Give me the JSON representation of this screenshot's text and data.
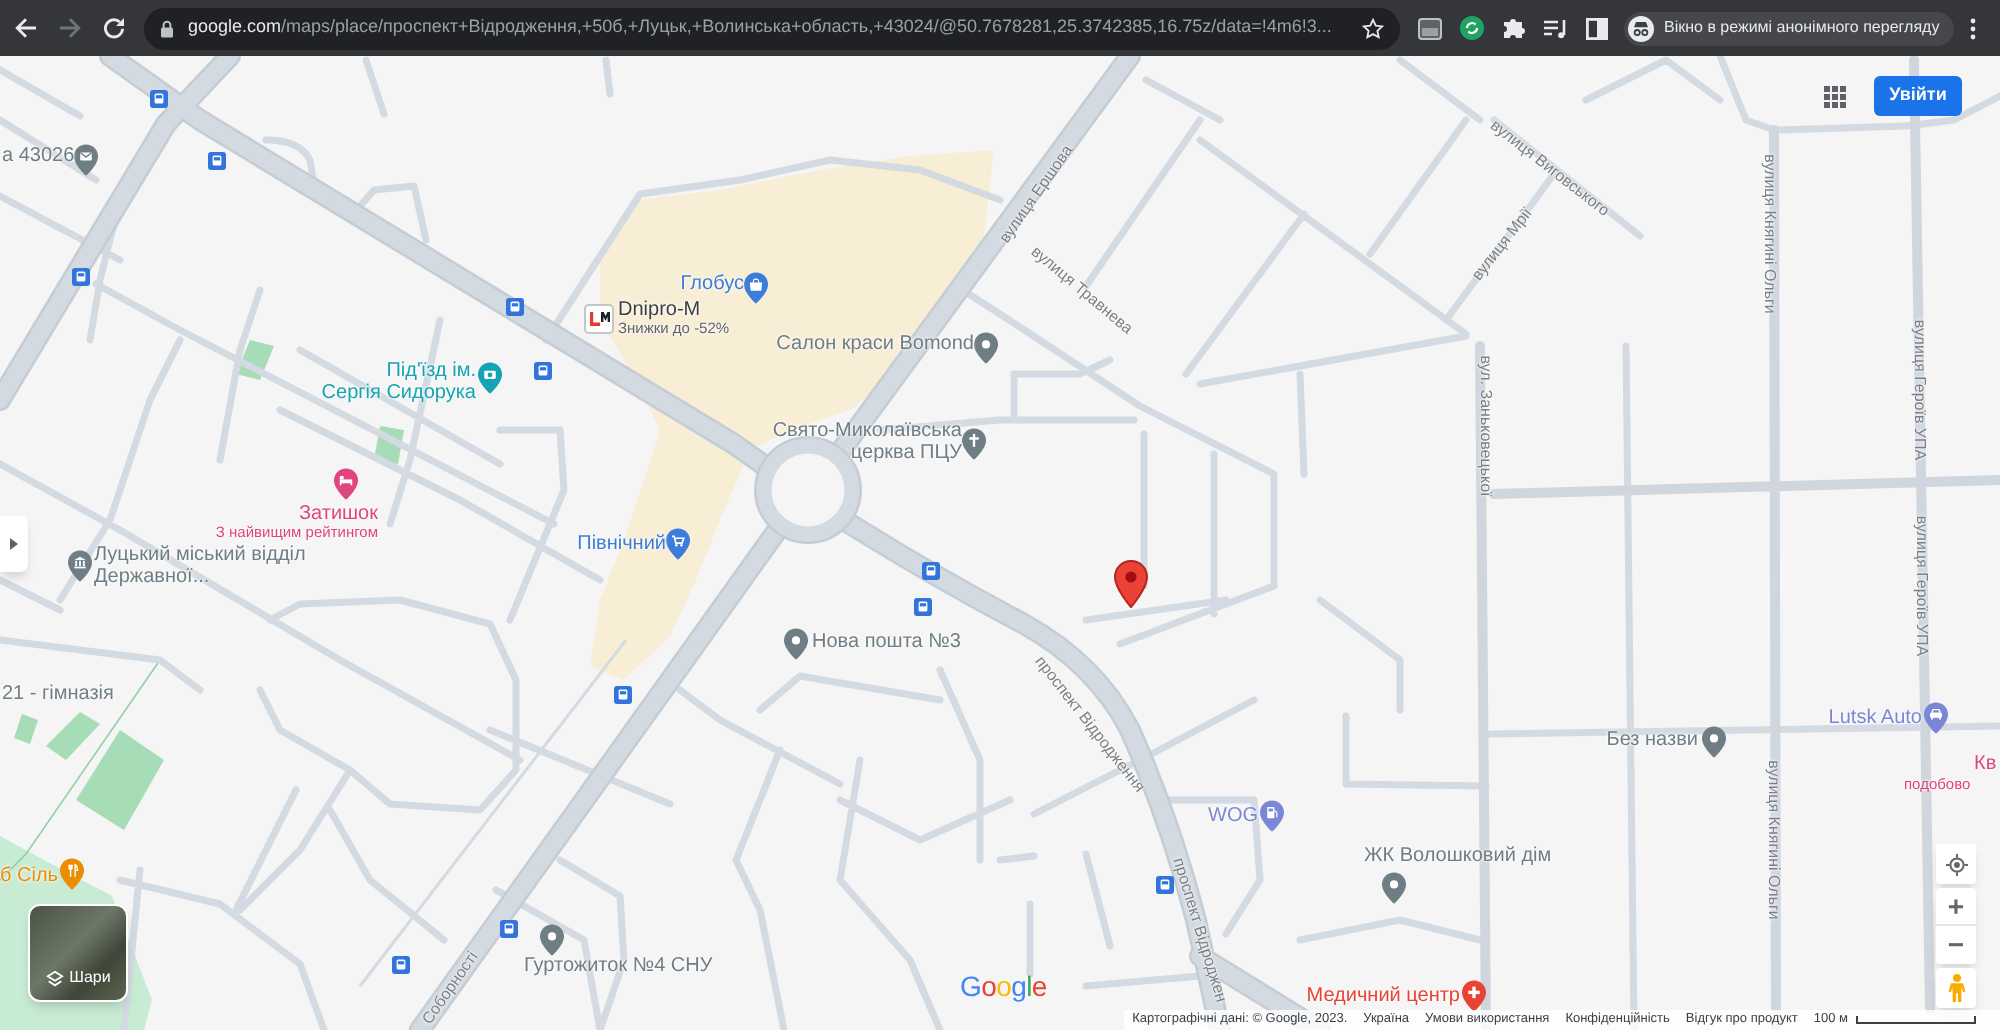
{
  "browser": {
    "forward_enabled": false,
    "url_host": "google.com",
    "url_path": "/maps/place/проспект+Відродження,+50б,+Луцьк,+Волинська+область,+43024/@50.7678281,25.3742385,16.75z/data=!4m6!3...",
    "incognito_label": "Вікно в режимі анонімного перегляду"
  },
  "header": {
    "sign_in_button": "Увійти"
  },
  "places": [
    {
      "kind": "pin",
      "name": "а 43026",
      "color": "#6f7d85"
    },
    {
      "kind": "pin",
      "name": "Глобус",
      "color": "#3c7ddc"
    },
    {
      "kind": "logo",
      "name": "Dnipro-M",
      "subtitle": "Знижки до -52%"
    },
    {
      "kind": "pin",
      "name": "Салон краси Bomond",
      "color": "#6f7d85"
    },
    {
      "kind": "pin",
      "name": "Свято-Миколаївська церква ПЦУ",
      "color": "#6f7d85"
    },
    {
      "kind": "pin",
      "name": "Під'їзд ім. Сергія Сидорука",
      "color": "#14a3b3"
    },
    {
      "kind": "pin",
      "name": "Затишок",
      "subtitle": "З найвищим рейтингом",
      "color": "#e0457f"
    },
    {
      "kind": "pin",
      "name": "Луцький міський відділ Державної...",
      "color": "#6f7d85"
    },
    {
      "kind": "pin",
      "name": "Північний",
      "color": "#3c7ddc"
    },
    {
      "kind": "pin",
      "name": "Нова пошта №3",
      "color": "#6f7d85"
    },
    {
      "kind": "label",
      "name": "21 - гімназія",
      "color": "#6f7d85"
    },
    {
      "kind": "pin",
      "name": "б Сіль",
      "color": "#ec8c00"
    },
    {
      "kind": "pin",
      "name": "Гуртожиток №4 СНУ",
      "color": "#6f7d85"
    },
    {
      "kind": "pin",
      "name": "WOG",
      "color": "#7b86d6"
    },
    {
      "kind": "pin",
      "name": "ЖК Волошковий дім",
      "color": "#6f7d85"
    },
    {
      "kind": "pin",
      "name": "Без назви",
      "color": "#6f7d85"
    },
    {
      "kind": "pin",
      "name": "Lutsk Auto",
      "color": "#7b86d6"
    },
    {
      "kind": "label",
      "name": "Кв",
      "subtitle": "подобово",
      "color": "#e0457f"
    },
    {
      "kind": "pin",
      "name": "Медичний центр",
      "color": "#ea4335"
    }
  ],
  "street_labels": [
    "вулиця Виговського",
    "вулиця Ершова",
    "вулиця Княгині Ольги",
    "вулиця Мрії",
    "вулиця Травнева",
    "вулиця Героїв УПА",
    "вул. Заньковецької",
    "вулиця Героїв УПА",
    "проспект Відродження",
    "вулиця Княгині Ольги",
    "проспект Відроджен",
    "Соборності"
  ],
  "layers_button": {
    "label": "Шари"
  },
  "logo": "Google",
  "map_controls": {
    "zoom_in": "+",
    "zoom_out": "−"
  },
  "footer": {
    "items": [
      "Картографічні дані: © Google, 2023.",
      "Україна",
      "Умови використання",
      "Конфіденційність",
      "Відгук про продукт"
    ],
    "scale": "100 м"
  }
}
